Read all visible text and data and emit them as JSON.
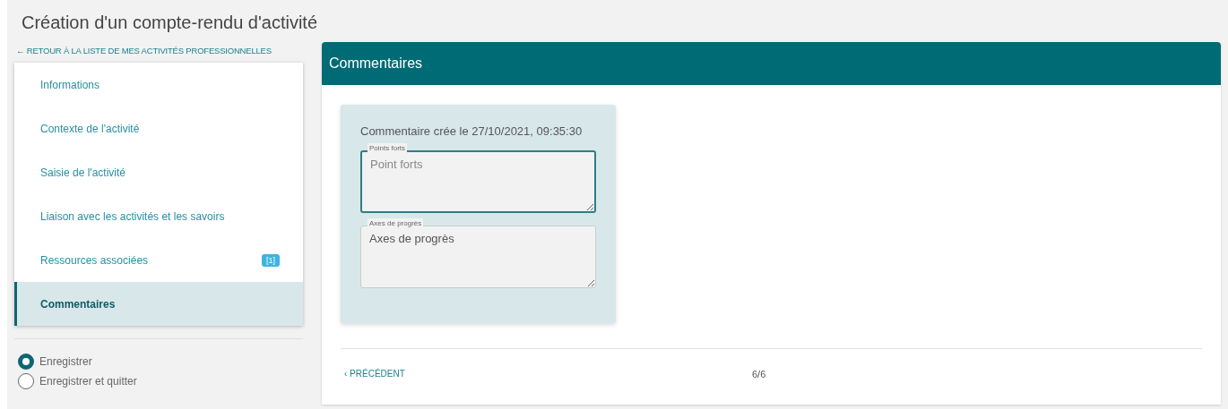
{
  "title": "Création d'un compte-rendu d'activité",
  "back_link": "← RETOUR À LA LISTE DE MES ACTIVITÉS PROFESSIONNELLES",
  "sidebar": {
    "items": [
      {
        "label": "Informations",
        "selected": false
      },
      {
        "label": "Contexte de l'activité",
        "selected": false
      },
      {
        "label": "Saisie de l'activité",
        "selected": false
      },
      {
        "label": "Liaison avec les activités et les savoirs",
        "selected": false
      },
      {
        "label": "Ressources associées",
        "selected": false,
        "badge": "[1]"
      },
      {
        "label": "Commentaires",
        "selected": true
      }
    ]
  },
  "save_options": [
    {
      "label": "Enregistrer",
      "selected": true
    },
    {
      "label": "Enregistrer et quitter",
      "selected": false
    }
  ],
  "panel": {
    "title": "Commentaires",
    "comment": {
      "created": "Commentaire crée le 27/10/2021, 09:35:30",
      "fields": [
        {
          "label": "Points forts",
          "placeholder": "Point forts",
          "focused": true
        },
        {
          "label": "Axes de progrès",
          "value": "Axes de progrès",
          "focused": false
        }
      ]
    },
    "previous": "‹ PRÉCÉDENT",
    "page": "6/6"
  }
}
